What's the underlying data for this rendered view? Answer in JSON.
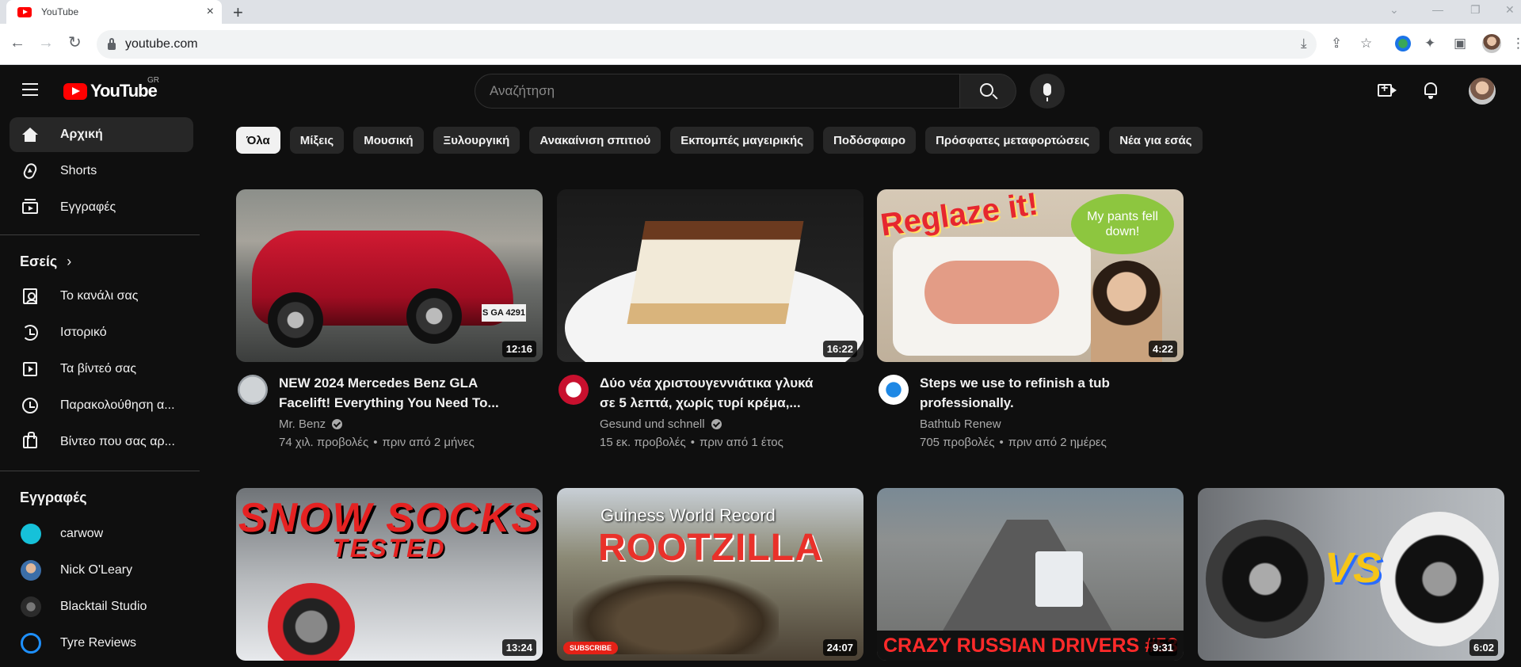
{
  "browser": {
    "tab_title": "YouTube",
    "tab_close": "×",
    "new_tab": "+",
    "url": "youtube.com"
  },
  "masthead": {
    "logo_text": "YouTube",
    "region": "GR",
    "search_placeholder": "Αναζήτηση"
  },
  "sidebar": {
    "main": [
      {
        "label": "Αρχική",
        "icon": "home-icon"
      },
      {
        "label": "Shorts",
        "icon": "shorts-icon"
      },
      {
        "label": "Εγγραφές",
        "icon": "subscriptions-icon"
      }
    ],
    "you_heading": "Εσείς",
    "you_chevron": "›",
    "you": [
      {
        "label": "Το κανάλι σας",
        "icon": "channel-icon"
      },
      {
        "label": "Ιστορικό",
        "icon": "history-icon"
      },
      {
        "label": "Τα βίντεό σας",
        "icon": "videos-icon"
      },
      {
        "label": "Παρακολούθηση α...",
        "icon": "watch-later-icon"
      },
      {
        "label": "Βίντεο που σας αρ...",
        "icon": "liked-icon"
      }
    ],
    "subs_heading": "Εγγραφές",
    "subscriptions": [
      {
        "label": "carwow",
        "color": "#16c1d9"
      },
      {
        "label": "Nick O'Leary",
        "color": "#3b6ea8"
      },
      {
        "label": "Blacktail Studio",
        "color": "#2b2b2b"
      },
      {
        "label": "Tyre Reviews",
        "color": "#0f0f0f"
      }
    ]
  },
  "chips": [
    "Όλα",
    "Μίξεις",
    "Μουσική",
    "Ξυλουργική",
    "Ανακαίνιση σπιτιού",
    "Εκπομπές μαγειρικής",
    "Ποδόσφαιρο",
    "Πρόσφατες μεταφορτώσεις",
    "Νέα για εσάς"
  ],
  "videos": [
    {
      "title_line1": "NEW 2024 Mercedes Benz GLA",
      "title_line2": "Facelift! Everything You Need To...",
      "channel": "Mr. Benz",
      "verified": true,
      "views": "74 χιλ. προβολές",
      "age": "πριν από 2 μήνες",
      "duration": "12:16",
      "plate": "S GA 4291"
    },
    {
      "title_line1": "Δύο νέα χριστουγεννιάτικα γλυκά",
      "title_line2": "σε 5 λεπτά, χωρίς τυρί κρέμα,...",
      "channel": "Gesund und schnell",
      "verified": true,
      "views": "15 εκ. προβολές",
      "age": "πριν από 1 έτος",
      "duration": "16:22"
    },
    {
      "title_line1": "Steps we use to refinish a tub",
      "title_line2": "professionally.",
      "channel": "Bathtub Renew",
      "verified": false,
      "views": "705 προβολές",
      "age": "πριν από 2 ημέρες",
      "duration": "4:22",
      "overlay_title": "Reglaze it!",
      "bubble_text": "My pants fell down!"
    },
    {
      "duration": "13:24",
      "overlay_line1": "SNOW SOCKS",
      "overlay_line2": "TESTED"
    },
    {
      "duration": "24:07",
      "overlay_line1": "Guiness World Record",
      "overlay_line2": "ROOTZILLA",
      "subscribe_badge": "SUBSCRIBE"
    },
    {
      "duration": "9:31",
      "overlay_line1": "CRAZY RUSSIAN DRIVERS #53"
    },
    {
      "duration": "6:02",
      "overlay_line1": "VS"
    }
  ],
  "stats_separator": "•"
}
